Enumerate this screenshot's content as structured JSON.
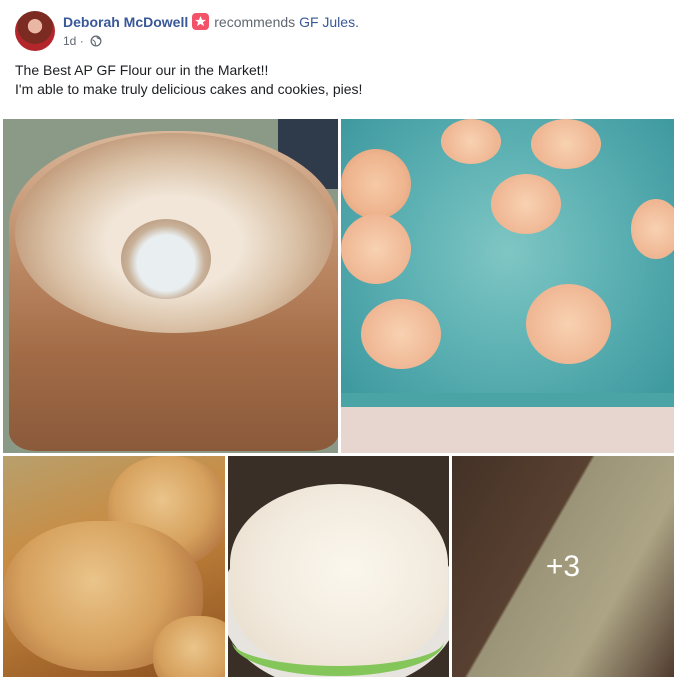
{
  "post": {
    "author": "Deborah McDowell",
    "recommends_text": "recommends",
    "page_name": "GF Jules.",
    "time": "1d",
    "separator": "·",
    "text_line1": "The Best AP GF Flour our in the Market!!",
    "text_line2": "I'm able to make truly delicious cakes and cookies, pies!"
  },
  "photos": {
    "more_count": "+3"
  },
  "colors": {
    "link": "#385898",
    "recommend_badge": "#f35369",
    "meta": "#606770"
  },
  "icons": {
    "recommend": "star-icon",
    "privacy": "globe-icon"
  }
}
